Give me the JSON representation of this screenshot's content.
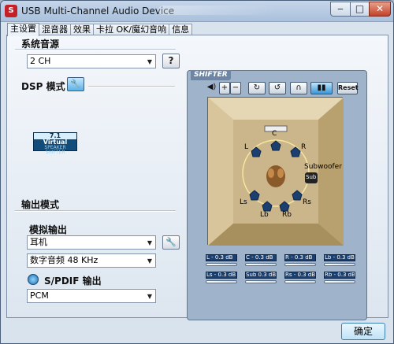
{
  "window": {
    "title": "USB Multi-Channel Audio Device",
    "controls": {
      "minimize": "‒",
      "maximize": "□",
      "close": "✕"
    }
  },
  "tabs": [
    "主设置",
    "混音器",
    "效果",
    "卡拉 OK/魔幻音响",
    "信息"
  ],
  "system_source": {
    "label": "系统音源",
    "value": "2 CH",
    "help": "?"
  },
  "dsp": {
    "label": "DSP 模式",
    "virtual_badge": {
      "top": "7.1",
      "mid": "Virtual",
      "bottom": "SPEAKER SHIFTER"
    }
  },
  "output": {
    "mode_label": "输出模式",
    "analog_label": "模拟输出",
    "analog_value": "耳机",
    "digital_audio_value": "数字音频 48 KHz",
    "spdif_label": "S/PDIF 输出",
    "spdif_value": "PCM"
  },
  "shifter": {
    "title": "SHIFTER",
    "reset": "Reset",
    "speakers": {
      "C": "C",
      "L": "L",
      "R": "R",
      "Ls": "Ls",
      "Rs": "Rs",
      "Lb": "Lb",
      "Rb": "Rb",
      "Sub": "Sub",
      "Subwoofer": "Subwoofer"
    },
    "levels": [
      {
        "ch": "L",
        "value": "0.3 dB",
        "text": "L - 0.3 dB",
        "level": 1.0
      },
      {
        "ch": "C",
        "value": "0.3 dB",
        "text": "C - 0.3 dB",
        "level": 1.0
      },
      {
        "ch": "R",
        "value": "0.3 dB",
        "text": "R - 0.3 dB",
        "level": 1.0
      },
      {
        "ch": "Lb",
        "value": "0.3 dB",
        "text": "Lb - 0.3 dB",
        "level": 1.0
      },
      {
        "ch": "Ls",
        "value": "0.3 dB",
        "text": "Ls - 0.3 dB",
        "level": 1.0
      },
      {
        "ch": "Sub",
        "value": "0.3 dB",
        "text": "Sub 0.3 dB",
        "level": 1.0
      },
      {
        "ch": "Rs",
        "value": "0.3 dB",
        "text": "Rs - 0.3 dB",
        "level": 1.0
      },
      {
        "ch": "Rb",
        "value": "0.3 dB",
        "text": "Rb - 0.3 dB",
        "level": 1.0
      }
    ]
  },
  "ok_button": "确定",
  "colors": {
    "accent": "#3f8fd0",
    "stage": "#c9b387",
    "chip": "#1b3f6e"
  }
}
